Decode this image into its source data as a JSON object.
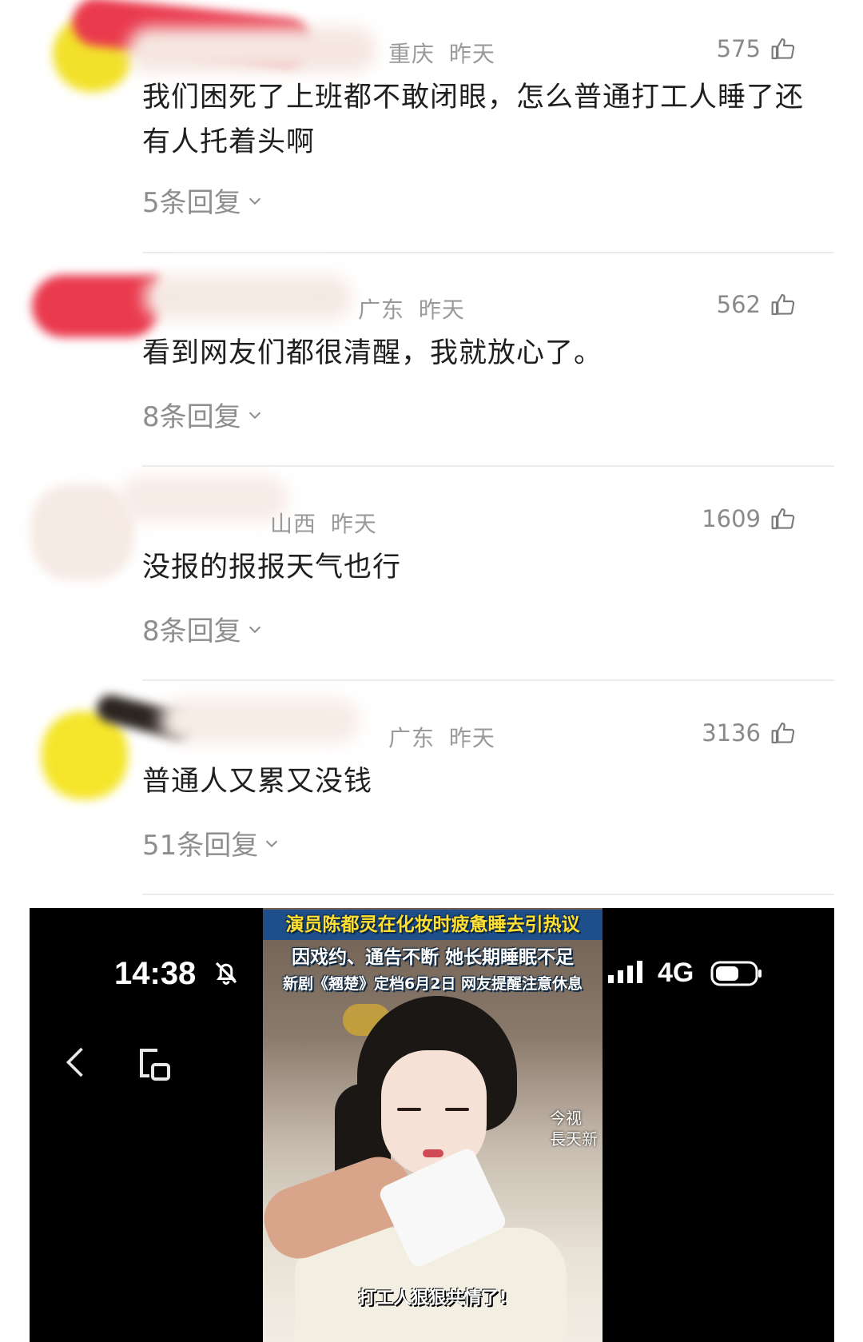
{
  "comments": [
    {
      "location": "重庆",
      "time": "昨天",
      "likes": "575",
      "text": "我们困死了上班都不敢闭眼，怎么普通打工人睡了还有人托着头啊",
      "replies": "5条回复"
    },
    {
      "location": "广东",
      "time": "昨天",
      "likes": "562",
      "text": "看到网友们都很清醒，我就放心了。",
      "replies": "8条回复"
    },
    {
      "location": "山西",
      "time": "昨天",
      "likes": "1609",
      "text": "没报的报报天气也行",
      "replies": "8条回复"
    },
    {
      "location": "广东",
      "time": "昨天",
      "likes": "3136",
      "text": "普通人又累又没钱",
      "replies": "51条回复"
    }
  ],
  "screenshot": {
    "status_time": "14:38",
    "network": "4G",
    "icons": [
      "mute-icon",
      "back-icon",
      "pip-icon",
      "signal-icon",
      "battery-icon"
    ],
    "headline_1": "演员陈都灵在化妆时疲惫睡去引热议",
    "headline_2": "因戏约、通告不断 她长期睡眠不足",
    "headline_3": "新剧《翘楚》定档6月2日 网友提醒注意休息",
    "watermark_1": "今视",
    "watermark_2": "長天新",
    "subtitle": "打工人狠狠共情了!"
  }
}
